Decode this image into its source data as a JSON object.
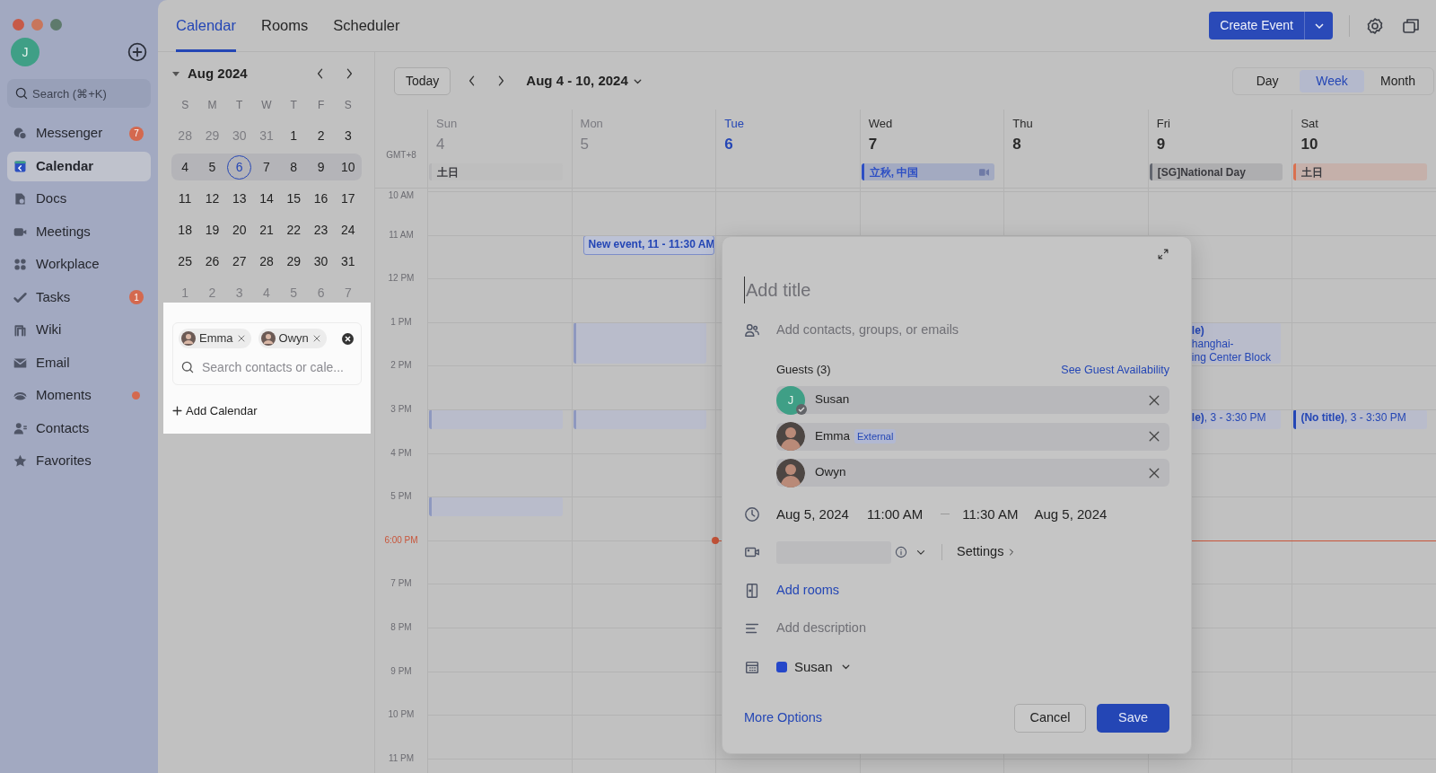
{
  "sidebar": {
    "avatar": "J",
    "search_placeholder": "Search (⌘+K)",
    "items": [
      {
        "label": "Messenger",
        "selected": false,
        "badge": "7",
        "unread_dot": false
      },
      {
        "label": "Calendar",
        "selected": true,
        "unread_dot": false
      },
      {
        "label": "Docs",
        "selected": false,
        "unread_dot": false
      },
      {
        "label": "Meetings",
        "selected": false,
        "unread_dot": false
      },
      {
        "label": "Workplace",
        "selected": false,
        "unread_dot": false
      },
      {
        "label": "Tasks",
        "selected": false,
        "badge": "1",
        "unread_dot": false
      },
      {
        "label": "Wiki",
        "selected": false,
        "unread_dot": false
      },
      {
        "label": "Email",
        "selected": false,
        "unread_dot": false
      },
      {
        "label": "Moments",
        "selected": false,
        "unread_dot": true
      },
      {
        "label": "Contacts",
        "selected": false,
        "unread_dot": false
      },
      {
        "label": "Favorites",
        "selected": false,
        "unread_dot": false
      }
    ]
  },
  "tabs": [
    {
      "label": "Calendar",
      "selected": true
    },
    {
      "label": "Rooms",
      "selected": false
    },
    {
      "label": "Scheduler",
      "selected": false
    }
  ],
  "create_button": "Create Event",
  "mini_calendar": {
    "month": "Aug 2024",
    "weekdays": [
      "S",
      "M",
      "T",
      "W",
      "T",
      "F",
      "S"
    ],
    "weeks": [
      {
        "current": false,
        "days": [
          {
            "d": "28",
            "outside": true,
            "today": false
          },
          {
            "d": "29",
            "outside": true,
            "today": false
          },
          {
            "d": "30",
            "outside": true,
            "today": false
          },
          {
            "d": "31",
            "outside": true,
            "today": false
          },
          {
            "d": "1",
            "outside": false,
            "today": false
          },
          {
            "d": "2",
            "outside": false,
            "today": false
          },
          {
            "d": "3",
            "outside": false,
            "today": false
          }
        ]
      },
      {
        "current": true,
        "days": [
          {
            "d": "4",
            "outside": false,
            "today": false
          },
          {
            "d": "5",
            "outside": false,
            "today": false
          },
          {
            "d": "6",
            "outside": false,
            "today": true
          },
          {
            "d": "7",
            "outside": false,
            "today": false
          },
          {
            "d": "8",
            "outside": false,
            "today": false
          },
          {
            "d": "9",
            "outside": false,
            "today": false
          },
          {
            "d": "10",
            "outside": false,
            "today": false
          }
        ]
      },
      {
        "current": false,
        "days": [
          {
            "d": "11",
            "outside": false,
            "today": false
          },
          {
            "d": "12",
            "outside": false,
            "today": false
          },
          {
            "d": "13",
            "outside": false,
            "today": false
          },
          {
            "d": "14",
            "outside": false,
            "today": false
          },
          {
            "d": "15",
            "outside": false,
            "today": false
          },
          {
            "d": "16",
            "outside": false,
            "today": false
          },
          {
            "d": "17",
            "outside": false,
            "today": false
          }
        ]
      },
      {
        "current": false,
        "days": [
          {
            "d": "18",
            "outside": false,
            "today": false
          },
          {
            "d": "19",
            "outside": false,
            "today": false
          },
          {
            "d": "20",
            "outside": false,
            "today": false
          },
          {
            "d": "21",
            "outside": false,
            "today": false
          },
          {
            "d": "22",
            "outside": false,
            "today": false
          },
          {
            "d": "23",
            "outside": false,
            "today": false
          },
          {
            "d": "24",
            "outside": false,
            "today": false
          }
        ]
      },
      {
        "current": false,
        "days": [
          {
            "d": "25",
            "outside": false,
            "today": false
          },
          {
            "d": "26",
            "outside": false,
            "today": false
          },
          {
            "d": "27",
            "outside": false,
            "today": false
          },
          {
            "d": "28",
            "outside": false,
            "today": false
          },
          {
            "d": "29",
            "outside": false,
            "today": false
          },
          {
            "d": "30",
            "outside": false,
            "today": false
          },
          {
            "d": "31",
            "outside": false,
            "today": false
          }
        ]
      },
      {
        "current": false,
        "days": [
          {
            "d": "1",
            "outside": true,
            "today": false
          },
          {
            "d": "2",
            "outside": true,
            "today": false
          },
          {
            "d": "3",
            "outside": true,
            "today": false
          },
          {
            "d": "4",
            "outside": true,
            "today": false
          },
          {
            "d": "5",
            "outside": true,
            "today": false
          },
          {
            "d": "6",
            "outside": true,
            "today": false
          },
          {
            "d": "7",
            "outside": true,
            "today": false
          }
        ]
      }
    ]
  },
  "calendar_picker": {
    "chips": [
      {
        "name": "Emma"
      },
      {
        "name": "Owyn"
      }
    ],
    "placeholder": "Search contacts or cale...",
    "add": "Add Calendar"
  },
  "toolbar": {
    "today": "Today",
    "range": "Aug 4 - 10, 2024",
    "views": [
      {
        "label": "Day",
        "selected": false
      },
      {
        "label": "Week",
        "selected": true
      },
      {
        "label": "Month",
        "selected": false
      }
    ]
  },
  "timezone": "GMT+8",
  "days": [
    {
      "name": "Sun",
      "date": "4",
      "today": false,
      "past": true,
      "all_day": [
        {
          "text": "土日",
          "color": "#b4b4b6",
          "icon": false
        }
      ],
      "events": [
        {
          "kind": "busy"
        },
        {
          "kind": "busy"
        }
      ]
    },
    {
      "name": "Mon",
      "date": "5",
      "today": false,
      "past": true,
      "events": [
        {
          "kind": "draft",
          "text": "New event, 11 - 11:30 AM"
        },
        {
          "kind": "busy"
        },
        {
          "kind": "busy"
        }
      ]
    },
    {
      "name": "Tue",
      "date": "6",
      "today": true,
      "past": false
    },
    {
      "name": "Wed",
      "date": "7",
      "today": false,
      "past": false,
      "all_day": [
        {
          "text": "立秋, 中国",
          "color": "#2d4fc4",
          "icon": true
        }
      ]
    },
    {
      "name": "Thu",
      "date": "8",
      "today": false,
      "past": false
    },
    {
      "name": "Fri",
      "date": "9",
      "today": false,
      "past": false,
      "all_day": [
        {
          "text": "[SG]National Day",
          "color": "#62666f",
          "icon": false
        }
      ],
      "events": [
        {
          "kind": "partial",
          "title": "le)",
          "lines": [
            "hanghai-",
            "ing Center Block"
          ]
        },
        {
          "kind": "partial",
          "text": "**le)**, 3 - 3:30 PM"
        }
      ]
    },
    {
      "name": "Sat",
      "date": "10",
      "today": false,
      "past": false,
      "all_day": [
        {
          "text": "土日",
          "color": "#d9704f",
          "icon": false
        }
      ],
      "events": [
        {
          "kind": "event",
          "text": "**(No title)**, 3 - 3:30 PM"
        }
      ]
    }
  ],
  "hours": [
    {
      "label": "10 AM",
      "current": false
    },
    {
      "label": "11 AM",
      "current": false
    },
    {
      "label": "12 PM",
      "current": false
    },
    {
      "label": "1 PM",
      "current": false
    },
    {
      "label": "2 PM",
      "current": false
    },
    {
      "label": "3 PM",
      "current": false
    },
    {
      "label": "4 PM",
      "current": false
    },
    {
      "label": "5 PM",
      "current": false
    },
    {
      "label": "6:00 PM",
      "current": true
    },
    {
      "label": "7 PM",
      "current": false
    },
    {
      "label": "8 PM",
      "current": false
    },
    {
      "label": "9 PM",
      "current": false
    },
    {
      "label": "10 PM",
      "current": false
    },
    {
      "label": "11 PM",
      "current": false
    }
  ],
  "event_dialog": {
    "title_placeholder": "Add title",
    "guests_placeholder": "Add contacts, groups, or emails",
    "guests_heading": "Guests (3)",
    "availability_link": "See Guest Availability",
    "guests": [
      {
        "name": "Susan",
        "kind": "letter",
        "avatar": "J",
        "confirmed": true
      },
      {
        "name": "Emma",
        "kind": "photo",
        "confirmed": false,
        "tag": "External"
      },
      {
        "name": "Owyn",
        "kind": "photo",
        "confirmed": false
      }
    ],
    "start_date": "Aug 5, 2024",
    "start_time": "11:00 AM",
    "end_time": "11:30 AM",
    "end_date": "Aug 5, 2024",
    "settings": "Settings",
    "rooms": "Add rooms",
    "description_placeholder": "Add description",
    "calendar": {
      "name": "Susan",
      "color": "#2547c9"
    },
    "more_options": "More Options",
    "cancel": "Cancel",
    "save": "Save"
  }
}
